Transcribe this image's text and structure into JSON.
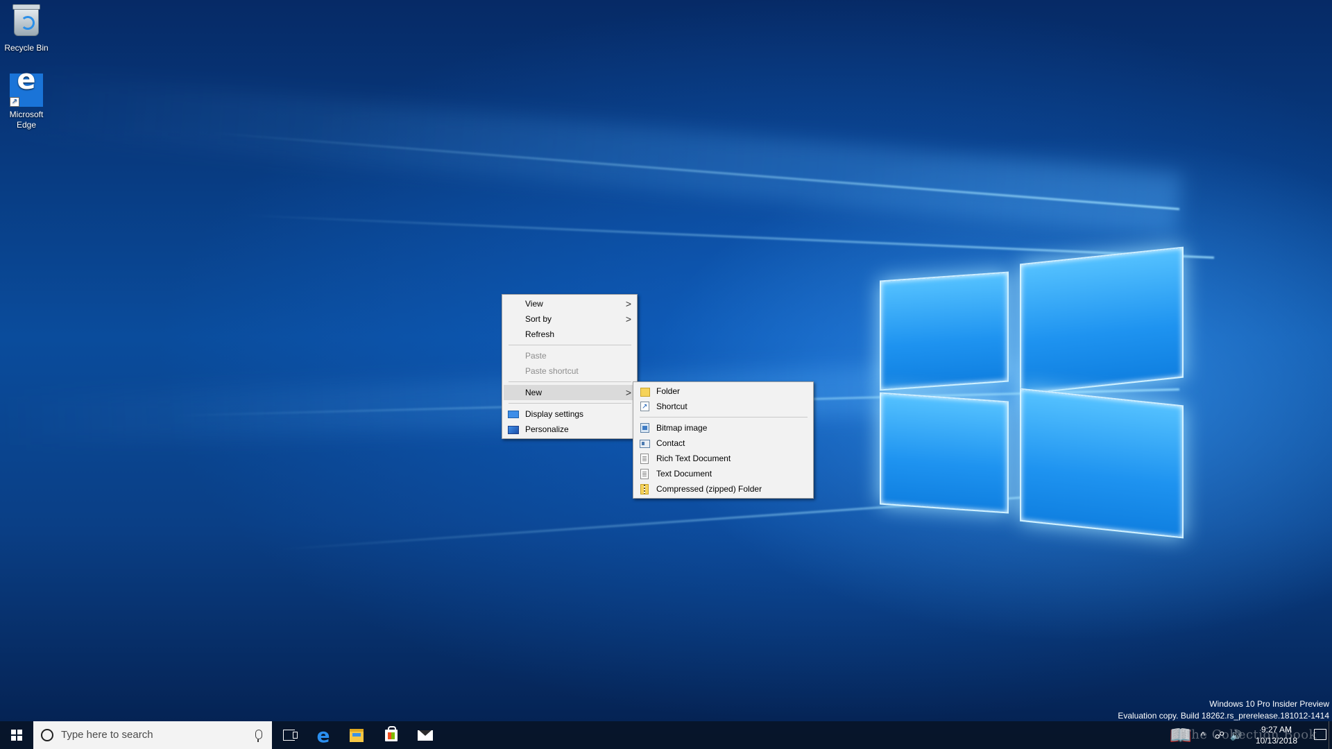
{
  "desktop": {
    "icons": [
      {
        "label": "Recycle Bin",
        "icon": "recycle-bin-icon"
      },
      {
        "label": "Microsoft Edge",
        "icon": "edge-icon"
      }
    ]
  },
  "context_menu": {
    "items": {
      "view": {
        "label": "View",
        "submenu": true
      },
      "sort_by": {
        "label": "Sort by",
        "submenu": true
      },
      "refresh": {
        "label": "Refresh"
      },
      "paste": {
        "label": "Paste",
        "disabled": true
      },
      "paste_shortcut": {
        "label": "Paste shortcut",
        "disabled": true
      },
      "new": {
        "label": "New",
        "submenu": true,
        "highlighted": true
      },
      "display_settings": {
        "label": "Display settings",
        "icon": "display-settings-icon"
      },
      "personalize": {
        "label": "Personalize",
        "icon": "personalize-icon"
      }
    },
    "arrow": ">"
  },
  "new_submenu": {
    "items": [
      {
        "label": "Folder",
        "icon": "folder-icon"
      },
      {
        "label": "Shortcut",
        "icon": "shortcut-icon"
      },
      {
        "label": "Bitmap image",
        "icon": "bitmap-image-icon"
      },
      {
        "label": "Contact",
        "icon": "contact-icon"
      },
      {
        "label": "Rich Text Document",
        "icon": "rich-text-document-icon"
      },
      {
        "label": "Text Document",
        "icon": "text-document-icon"
      },
      {
        "label": "Compressed (zipped) Folder",
        "icon": "zip-folder-icon"
      }
    ]
  },
  "watermark": {
    "line1": "Windows 10 Pro Insider Preview",
    "line2": "Evaluation copy. Build 18262.rs_prerelease.181012-1414",
    "overlay": "The Collection Book"
  },
  "taskbar": {
    "search_placeholder": "Type here to search",
    "pinned": [
      "task-view-icon",
      "edge-icon",
      "file-explorer-icon",
      "store-icon",
      "mail-icon"
    ],
    "tray": {
      "time": "9:27 AM",
      "date": "10/13/2018",
      "chevron": "^"
    }
  },
  "colors": {
    "taskbar": "#08142c",
    "menu_bg": "#f2f2f2",
    "highlight": "#dadada",
    "accent": "#1a74d8"
  }
}
